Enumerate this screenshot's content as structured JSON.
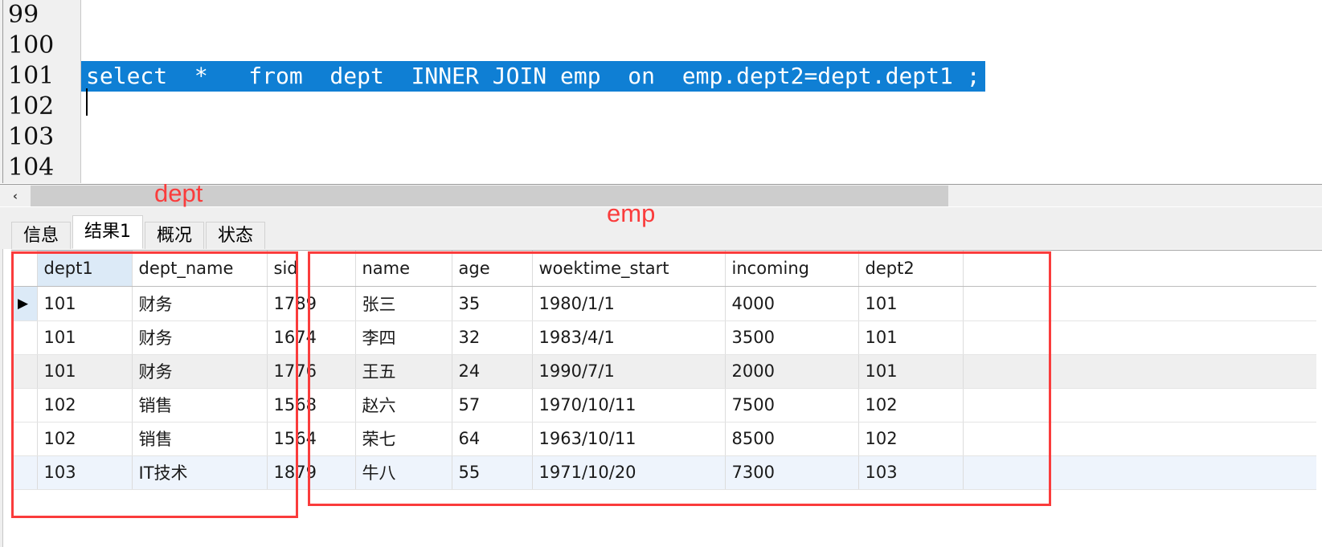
{
  "editor": {
    "gutter_lines": [
      "99",
      "100",
      "101",
      "102",
      "103",
      "104"
    ],
    "lines": [
      {
        "num": "99",
        "text": "",
        "selected": false
      },
      {
        "num": "100",
        "text": "",
        "selected": false
      },
      {
        "num": "101",
        "text": "select  *   from  dept  INNER JOIN emp  on  emp.dept2=dept.dept1 ;",
        "selected": true
      },
      {
        "num": "102",
        "text": "",
        "selected": false
      },
      {
        "num": "103",
        "text": "",
        "selected": false
      },
      {
        "num": "104",
        "text": "",
        "selected": false
      }
    ],
    "selection_color": "#0f7fd4"
  },
  "scrollbar": {
    "left_button_glyph": "‹"
  },
  "tabs": [
    {
      "label": "信息",
      "active": false
    },
    {
      "label": "结果1",
      "active": true
    },
    {
      "label": "概况",
      "active": false
    },
    {
      "label": "状态",
      "active": false
    }
  ],
  "annotations": [
    {
      "label": "dept",
      "color": "#fa3c3c"
    },
    {
      "label": "emp",
      "color": "#fa3c3c"
    }
  ],
  "grid": {
    "columns": [
      {
        "key": "dept1",
        "label": "dept1",
        "align": "left",
        "selected": true
      },
      {
        "key": "dept_name",
        "label": "dept_name",
        "align": "left",
        "selected": false
      },
      {
        "key": "sid",
        "label": "sid",
        "align": "left",
        "selected": false
      },
      {
        "key": "name",
        "label": "name",
        "align": "left",
        "selected": false
      },
      {
        "key": "age",
        "label": "age",
        "align": "right",
        "selected": false
      },
      {
        "key": "woektime_start",
        "label": "woektime_start",
        "align": "left",
        "selected": false
      },
      {
        "key": "incoming",
        "label": "incoming",
        "align": "right",
        "selected": false
      },
      {
        "key": "dept2",
        "label": "dept2",
        "align": "left",
        "selected": false
      }
    ],
    "rows": [
      {
        "dept1": "101",
        "dept_name": "财务",
        "sid": "1789",
        "name": "张三",
        "age": "35",
        "woektime_start": "1980/1/1",
        "incoming": "4000",
        "dept2": "101",
        "style": "current"
      },
      {
        "dept1": "101",
        "dept_name": "财务",
        "sid": "1674",
        "name": "李四",
        "age": "32",
        "woektime_start": "1983/4/1",
        "incoming": "3500",
        "dept2": "101",
        "style": "normal"
      },
      {
        "dept1": "101",
        "dept_name": "财务",
        "sid": "1776",
        "name": "王五",
        "age": "24",
        "woektime_start": "1990/7/1",
        "incoming": "2000",
        "dept2": "101",
        "style": "alt"
      },
      {
        "dept1": "102",
        "dept_name": "销售",
        "sid": "1568",
        "name": "赵六",
        "age": "57",
        "woektime_start": "1970/10/11",
        "incoming": "7500",
        "dept2": "102",
        "style": "normal"
      },
      {
        "dept1": "102",
        "dept_name": "销售",
        "sid": "1564",
        "name": "荣七",
        "age": "64",
        "woektime_start": "1963/10/11",
        "incoming": "8500",
        "dept2": "102",
        "style": "normal"
      },
      {
        "dept1": "103",
        "dept_name": "IT技术",
        "sid": "1879",
        "name": "牛八",
        "age": "55",
        "woektime_start": "1971/10/20",
        "incoming": "7300",
        "dept2": "103",
        "style": "sel"
      }
    ],
    "row_indicator_glyph": "▶"
  }
}
